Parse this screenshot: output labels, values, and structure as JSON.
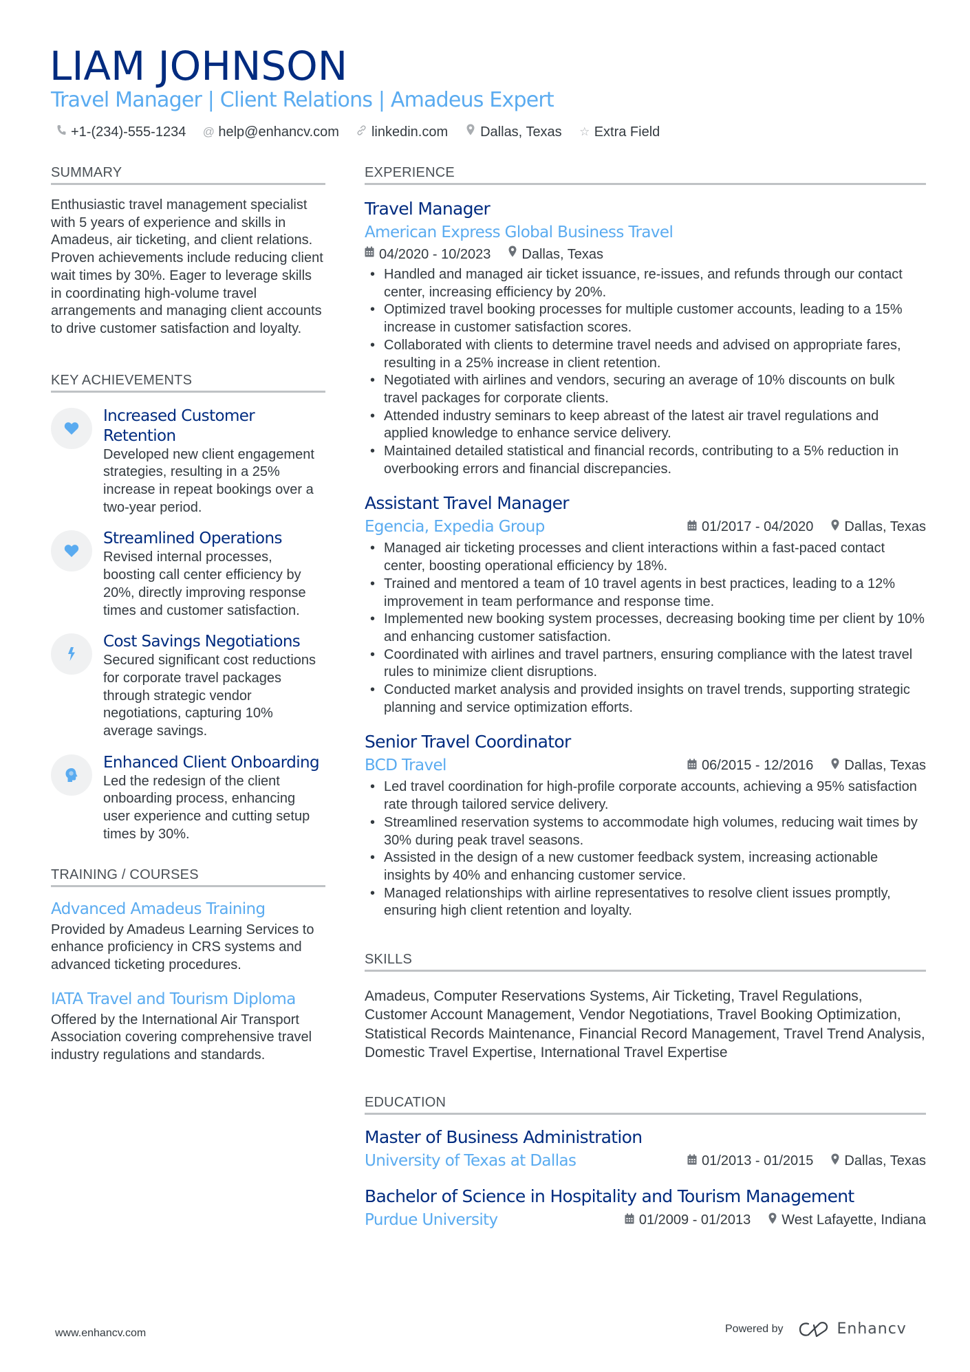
{
  "header": {
    "name": "LIAM JOHNSON",
    "title": "Travel Manager | Client Relations | Amadeus Expert",
    "contacts": [
      {
        "icon": "phone-icon",
        "text": "+1-(234)-555-1234"
      },
      {
        "icon": "at-icon",
        "text": "help@enhancv.com"
      },
      {
        "icon": "link-icon",
        "text": "linkedin.com"
      },
      {
        "icon": "location-icon",
        "text": "Dallas, Texas"
      },
      {
        "icon": "star-icon",
        "text": "Extra Field"
      }
    ]
  },
  "summary": {
    "title": "SUMMARY",
    "text": "Enthusiastic travel management specialist with 5 years of experience and skills in Amadeus, air ticketing, and client relations. Proven achievements include reducing client wait times by 30%. Eager to leverage skills in coordinating high-volume travel arrangements and managing client accounts to drive customer satisfaction and loyalty."
  },
  "achievements": {
    "title": "KEY ACHIEVEMENTS",
    "items": [
      {
        "icon": "heart-icon",
        "title": "Increased Customer Retention",
        "text": "Developed new client engagement strategies, resulting in a 25% increase in repeat bookings over a two-year period."
      },
      {
        "icon": "heart-icon",
        "title": "Streamlined Operations",
        "text": "Revised internal processes, boosting call center efficiency by 20%, directly improving response times and customer satisfaction."
      },
      {
        "icon": "lightning-icon",
        "title": "Cost Savings Negotiations",
        "text": "Secured significant cost reductions for corporate travel packages through strategic vendor negotiations, capturing 10% average savings."
      },
      {
        "icon": "head-brain-icon",
        "title": "Enhanced Client Onboarding",
        "text": "Led the redesign of the client onboarding process, enhancing user experience and cutting setup times by 30%."
      }
    ]
  },
  "training": {
    "title": "TRAINING / COURSES",
    "items": [
      {
        "title": "Advanced Amadeus Training",
        "text": "Provided by Amadeus Learning Services to enhance proficiency in CRS systems and advanced ticketing procedures."
      },
      {
        "title": "IATA Travel and Tourism Diploma",
        "text": "Offered by the International Air Transport Association covering comprehensive travel industry regulations and standards."
      }
    ]
  },
  "experience": {
    "title": "EXPERIENCE",
    "jobs": [
      {
        "title": "Travel Manager",
        "company": "American Express Global Business Travel",
        "dates": "04/2020 - 10/2023",
        "location": "Dallas, Texas",
        "bullets": [
          "Handled and managed air ticket issuance, re-issues, and refunds through our contact center, increasing efficiency by 20%.",
          "Optimized travel booking processes for multiple customer accounts, leading to a 15% increase in customer satisfaction scores.",
          "Collaborated with clients to determine travel needs and advised on appropriate fares, resulting in a 25% increase in client retention.",
          "Negotiated with airlines and vendors, securing an average of 10% discounts on bulk travel packages for corporate clients.",
          "Attended industry seminars to keep abreast of the latest air travel regulations and applied knowledge to enhance service delivery.",
          "Maintained detailed statistical and financial records, contributing to a 5% reduction in overbooking errors and financial discrepancies."
        ]
      },
      {
        "title": "Assistant Travel Manager",
        "company": "Egencia, Expedia Group",
        "dates": "01/2017 - 04/2020",
        "location": "Dallas, Texas",
        "bullets": [
          "Managed air ticketing processes and client interactions within a fast-paced contact center, boosting operational efficiency by 18%.",
          "Trained and mentored a team of 10 travel agents in best practices, leading to a 12% improvement in team performance and response time.",
          "Implemented new booking system processes, decreasing booking time per client by 10% and enhancing customer satisfaction.",
          "Coordinated with airlines and travel partners, ensuring compliance with the latest travel rules to minimize client disruptions.",
          "Conducted market analysis and provided insights on travel trends, supporting strategic planning and service optimization efforts."
        ]
      },
      {
        "title": "Senior Travel Coordinator",
        "company": "BCD Travel",
        "dates": "06/2015 - 12/2016",
        "location": "Dallas, Texas",
        "bullets": [
          "Led travel coordination for high-profile corporate accounts, achieving a 95% satisfaction rate through tailored service delivery.",
          "Streamlined reservation systems to accommodate high volumes, reducing wait times by 30% during peak travel seasons.",
          "Assisted in the design of a new customer feedback system, increasing actionable insights by 40% and enhancing customer service.",
          "Managed relationships with airline representatives to resolve client issues promptly, ensuring high client retention and loyalty."
        ]
      }
    ]
  },
  "skills": {
    "title": "SKILLS",
    "text": "Amadeus, Computer Reservations Systems, Air Ticketing, Travel Regulations, Customer Account Management, Vendor Negotiations, Travel Booking Optimization, Statistical Records Maintenance, Financial Record Management, Travel Trend Analysis, Domestic Travel Expertise, International Travel Expertise"
  },
  "education": {
    "title": "EDUCATION",
    "items": [
      {
        "degree": "Master of Business Administration",
        "school": "University of Texas at Dallas",
        "dates": "01/2013 - 01/2015",
        "location": "Dallas, Texas"
      },
      {
        "degree": "Bachelor of Science in Hospitality and Tourism Management",
        "school": "Purdue University",
        "dates": "01/2009 - 01/2013",
        "location": "West Lafayette, Indiana"
      }
    ]
  },
  "footer": {
    "website": "www.enhancv.com",
    "powered_by": "Powered by",
    "brand": "Enhancv"
  },
  "colors": {
    "name": "#002b7f",
    "accent": "#5aabf0",
    "text": "#333a40",
    "divider": "#bfc2c5",
    "icon_bg": "#f0f1f2"
  }
}
